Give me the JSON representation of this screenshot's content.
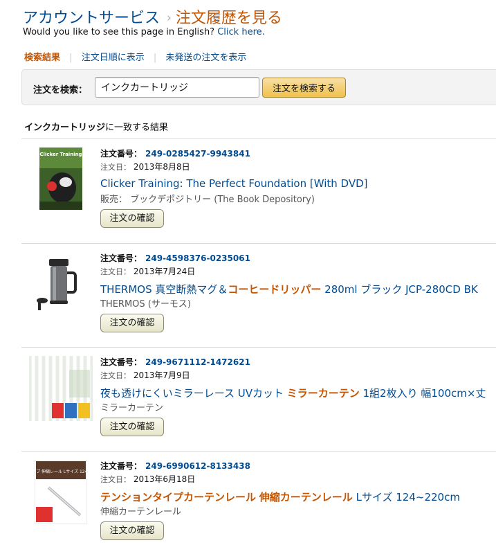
{
  "header": {
    "breadcrumb_account": "アカウントサービス",
    "breadcrumb_separator": "›",
    "breadcrumb_current": "注文履歴を見る",
    "english_prompt": "Would you like to see this page in English?",
    "english_link": "Click here."
  },
  "filters": [
    {
      "label": "検索結果",
      "active": true
    },
    {
      "label": "注文日順に表示",
      "active": false
    },
    {
      "label": "未発送の注文を表示",
      "active": false
    }
  ],
  "filter_separator": "|",
  "search": {
    "label": "注文を検索：",
    "value": "インクカートリッジ",
    "button_label": "注文を検索する"
  },
  "results_heading": {
    "query": "インクカートリッジ",
    "suffix": "に一致する結果"
  },
  "order_number_label": "注文番号：",
  "order_date_label": "注文日：",
  "confirm_label": "注文の確認",
  "orders": [
    {
      "order_number": "249-0285427-9943841",
      "date": "2013年8月8日",
      "title": [
        {
          "text": "Clicker Training: The Perfect Foundation [With DVD]",
          "hl": false
        }
      ],
      "seller": "販売： ブックデポジトリー (The Book Depository)",
      "thumb_icon": "book-cover-icon",
      "thumb_text": "Clicker Training"
    },
    {
      "order_number": "249-4598376-0235061",
      "date": "2013年7月24日",
      "title": [
        {
          "text": "THERMOS 真空断熱マグ＆",
          "hl": false
        },
        {
          "text": "コーヒードリッパー",
          "hl": true
        },
        {
          "text": " 280ml ブラック JCP-280CD BK",
          "hl": false
        }
      ],
      "seller": "THERMOS (サーモス)",
      "thumb_icon": "thermos-mug-icon"
    },
    {
      "order_number": "249-9671112-1472621",
      "date": "2013年7月9日",
      "title": [
        {
          "text": "夜も透けにくいミラーレース UVカット ",
          "hl": false
        },
        {
          "text": "ミラーカーテン",
          "hl": true
        },
        {
          "text": " 1組2枚入り 幅100cm×丈",
          "hl": false
        }
      ],
      "seller": "ミラーカーテン",
      "thumb_icon": "lace-curtain-icon"
    },
    {
      "order_number": "249-6990612-8133438",
      "date": "2013年6月18日",
      "title": [
        {
          "text": "テンションタイプカーテンレール",
          "hl": true
        },
        {
          "text": " ",
          "hl": false
        },
        {
          "text": "伸縮カーテンレール",
          "hl": true
        },
        {
          "text": " Lサイズ 124~220cm",
          "hl": false
        }
      ],
      "seller": "伸縮カーテンレール",
      "thumb_icon": "curtain-rail-icon",
      "thumb_text": "テンションタイプ 伸縮レール Lサイズ 124~220cm 対応"
    }
  ],
  "colors": {
    "link": "#004b91",
    "accent": "#c45500",
    "search_button": "#f0c14b"
  }
}
